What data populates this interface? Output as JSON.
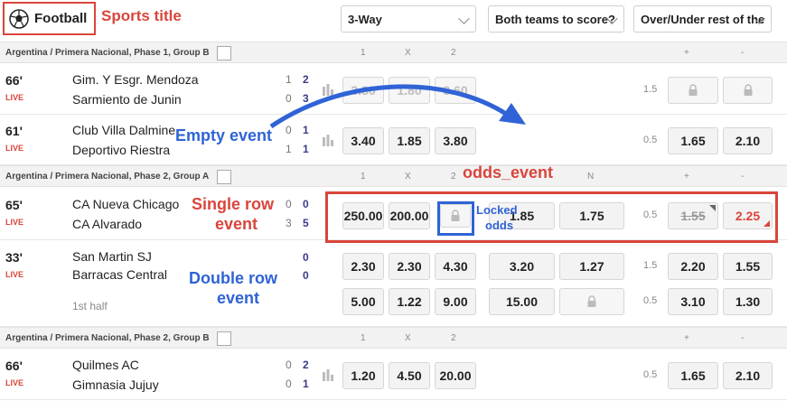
{
  "header": {
    "sport_label": "Football",
    "selects": [
      {
        "label": "3-Way"
      },
      {
        "label": "Both teams to score?"
      },
      {
        "label": "Over/Under rest of the"
      }
    ]
  },
  "annotations": {
    "sports_title": "Sports title",
    "empty_event": "Empty event",
    "odds_event": "odds_event",
    "single_row_1": "Single row",
    "single_row_2": "event",
    "locked_odds_1": "Locked",
    "locked_odds_2": "odds",
    "double_row_1": "Double row",
    "double_row_2": "event"
  },
  "groups": [
    {
      "name": "Argentina / Primera Nacional, Phase 1, Group B",
      "h1": "1",
      "hx": "X",
      "h2": "2",
      "hplus": "+",
      "hminus": "-"
    },
    {
      "name": "Argentina / Primera Nacional, Phase 2, Group A",
      "h1": "1",
      "hx": "X",
      "h2": "2",
      "hn": "N",
      "hplus": "+",
      "hminus": "-"
    },
    {
      "name": "Argentina / Primera Nacional, Phase 2, Group B",
      "h1": "1",
      "hx": "X",
      "h2": "2",
      "hplus": "+",
      "hminus": "-"
    }
  ],
  "events": [
    {
      "minute": "66'",
      "live": "LIVE",
      "home": "Gim. Y Esgr. Mendoza",
      "away": "Sarmiento de Junin",
      "s1h": "1",
      "s2h": "2",
      "s1a": "0",
      "s2a": "3",
      "odds": [
        "3.80",
        "1.80",
        "3.60"
      ],
      "hcp": "1.5"
    },
    {
      "minute": "61'",
      "live": "LIVE",
      "home": "Club Villa Dalmine",
      "away": "Deportivo Riestra",
      "s1h": "0",
      "s2h": "1",
      "s1a": "1",
      "s2a": "1",
      "odds": [
        "3.40",
        "1.85",
        "3.80"
      ],
      "hcp": "0.5",
      "ou": [
        "1.65",
        "2.10"
      ]
    },
    {
      "minute": "65'",
      "live": "LIVE",
      "home": "CA Nueva Chicago",
      "away": "CA Alvarado",
      "s1h": "0",
      "s2h": "0",
      "s1a": "3",
      "s2a": "5",
      "odds": [
        "250.00",
        "200.00"
      ],
      "btts": [
        "1.85",
        "1.75"
      ],
      "hcp": "0.5",
      "ou": [
        "1.55",
        "2.25"
      ]
    },
    {
      "minute": "33'",
      "live": "LIVE",
      "home": "San Martin SJ",
      "away": "Barracas Central",
      "s1h": "0",
      "s2h": "",
      "s1a": "0",
      "s2a": "",
      "half": "1st half",
      "odds": [
        "2.30",
        "2.30",
        "4.30"
      ],
      "btts": [
        "3.20",
        "1.27"
      ],
      "hcp": "1.5",
      "ou": [
        "2.20",
        "1.55"
      ],
      "odds2": [
        "5.00",
        "1.22",
        "9.00"
      ],
      "btts2": [
        "15.00"
      ],
      "hcp2": "0.5",
      "ou2": [
        "3.10",
        "1.30"
      ]
    },
    {
      "minute": "66'",
      "live": "LIVE",
      "home": "Quilmes AC",
      "away": "Gimnasia Jujuy",
      "s1h": "0",
      "s2h": "2",
      "s1a": "0",
      "s2a": "1",
      "odds": [
        "1.20",
        "4.50",
        "20.00"
      ],
      "hcp": "0.5",
      "ou": [
        "1.65",
        "2.10"
      ]
    }
  ],
  "colors": {
    "accent": "#d9453b",
    "annotation_blue": "#2f63d6"
  }
}
